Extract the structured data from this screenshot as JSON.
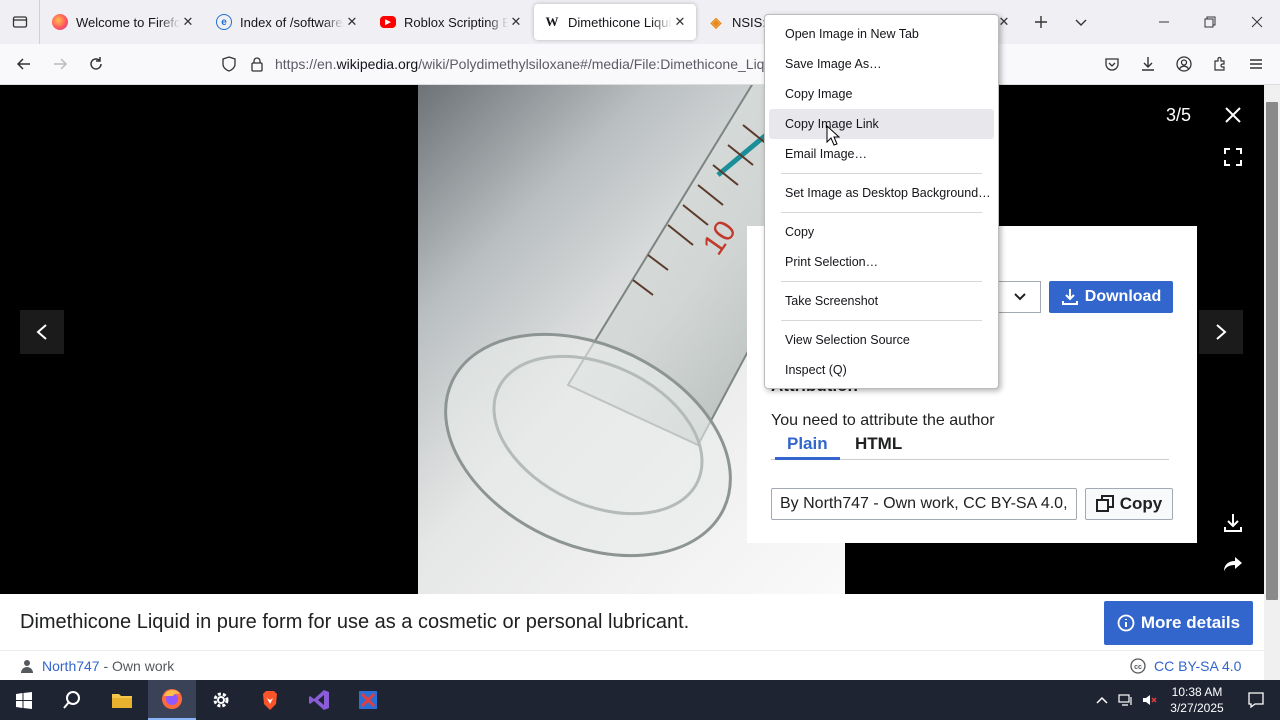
{
  "browser": {
    "tabs": [
      {
        "title": "Welcome to Firefox",
        "favicon": "firefox-icon",
        "active": false
      },
      {
        "title": "Index of /software/…",
        "favicon": "ie-page-icon",
        "active": false
      },
      {
        "title": "Roblox Scripting Be…",
        "favicon": "youtube-icon",
        "active": false
      },
      {
        "title": "Dimethicone Liquid",
        "favicon": "wikipedia-icon",
        "active": true
      },
      {
        "title": "NSIS: N",
        "favicon": "nsis-icon",
        "active": false
      }
    ],
    "url_prefix": "https://en.",
    "url_domain": "wikipedia.org",
    "url_path": "/wiki/Polydimethylsiloxane#/media/File:Dimethicone_Liqu"
  },
  "viewer": {
    "counter": "3/5",
    "download_label": "Download",
    "attribution_heading": "Attribution",
    "attribution_text": "You need to attribute the author",
    "tab_plain": "Plain",
    "tab_html": "HTML",
    "attribution_value": "By North747 - Own work, CC BY-SA 4.0, ",
    "copy_label": "Copy",
    "measure_label": "10",
    "caption": "Dimethicone Liquid in pure form for use as a cosmetic or personal lubricant.",
    "more_details_label": "More details",
    "author": "North747",
    "author_suffix": " - Own work",
    "license": "CC BY-SA 4.0"
  },
  "context_menu": {
    "items": [
      "Open Image in New Tab",
      "Save Image As…",
      "Copy Image",
      "Copy Image Link",
      "Email Image…",
      "Set Image as Desktop Background…",
      "Copy",
      "Print Selection…",
      "Take Screenshot",
      "View Selection Source",
      "Inspect (Q)"
    ]
  },
  "taskbar": {
    "time": "10:38 AM",
    "date": "3/27/2025"
  },
  "colors": {
    "accent": "#3366cc",
    "tabstrip": "#f0f0f4",
    "taskbar": "#1f2433"
  }
}
